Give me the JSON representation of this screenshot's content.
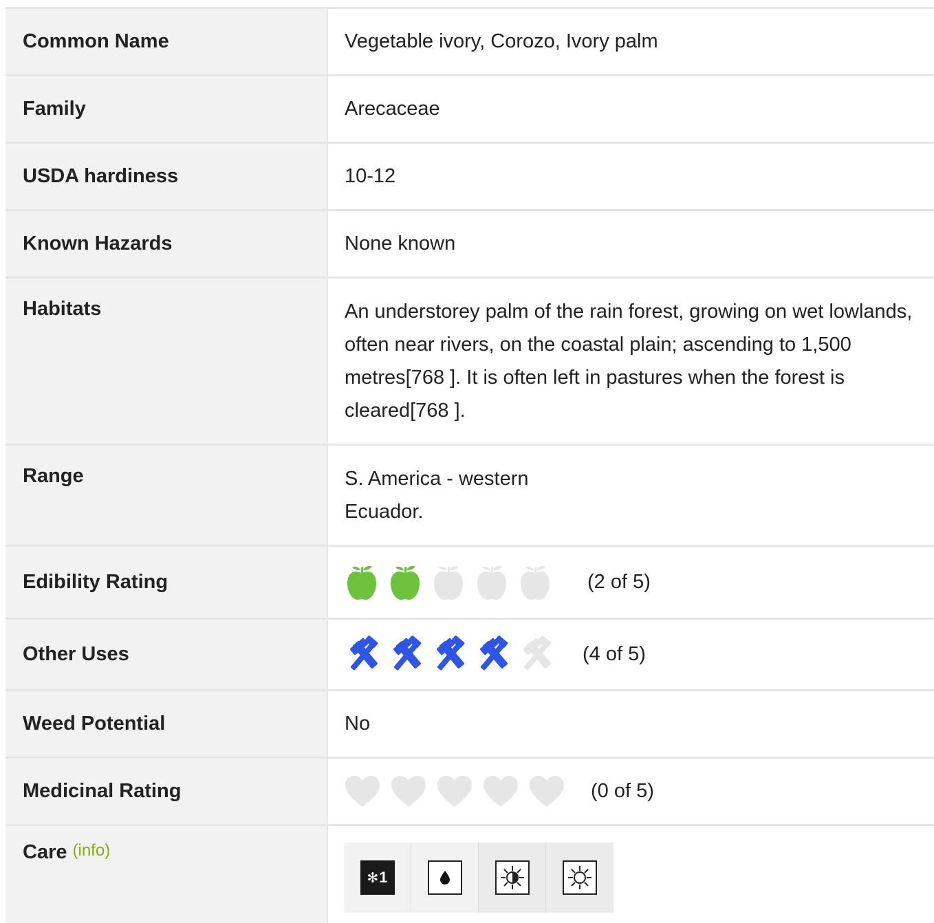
{
  "rows": {
    "common_name": {
      "label": "Common Name",
      "value": "Vegetable ivory, Corozo, Ivory palm"
    },
    "family": {
      "label": "Family",
      "value": "Arecaceae"
    },
    "usda": {
      "label": "USDA hardiness",
      "value": "10-12"
    },
    "hazards": {
      "label": "Known Hazards",
      "value": "None known"
    },
    "habitats": {
      "label": "Habitats",
      "value": "An understorey palm of the rain forest, growing on wet lowlands, often near rivers, on the coastal plain; ascending to 1,500 metres[768 ]. It is often left in pastures when the forest is cleared[768 ]."
    },
    "range": {
      "label": "Range",
      "value": "S. America - western Ecuador."
    },
    "edibility": {
      "label": "Edibility Rating",
      "rating": 2,
      "max": 5,
      "text": "(2 of 5)",
      "icon": "apple-icon",
      "active_color": "#6cc13d",
      "inactive_color": "#e6e6e6"
    },
    "other_uses": {
      "label": "Other Uses",
      "rating": 4,
      "max": 5,
      "text": "(4 of 5)",
      "icon": "tools-icon",
      "active_color": "#2f55e6",
      "inactive_color": "#e6e6e6"
    },
    "weed": {
      "label": "Weed Potential",
      "value": "No"
    },
    "medicinal": {
      "label": "Medicinal Rating",
      "rating": 0,
      "max": 5,
      "text": "(0 of 5)",
      "icon": "heart-icon",
      "active_color": "#e03030",
      "inactive_color": "#e6e6e6"
    },
    "care": {
      "label": "Care",
      "info_link": "(info)",
      "info_color": "#88a81a",
      "icons": [
        {
          "name": "frost-hardiness-icon",
          "text": "1"
        },
        {
          "name": "moist-soil-icon"
        },
        {
          "name": "semi-shade-icon"
        },
        {
          "name": "full-sun-icon"
        }
      ]
    }
  }
}
